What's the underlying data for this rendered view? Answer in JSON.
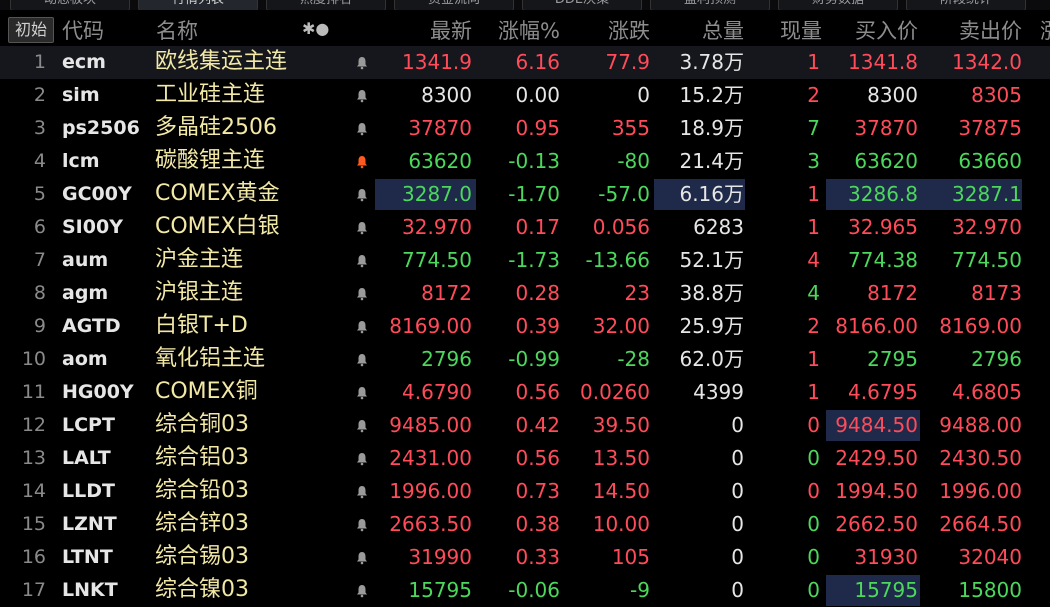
{
  "tabs": [
    "动态板块",
    "行情列表",
    "热度排名",
    "资金流向",
    "DDE决策",
    "盈利预测",
    "财务数据",
    "阶段统计"
  ],
  "init_button": "初始",
  "header": {
    "code": "代码",
    "name": "名称",
    "icon": "✱●",
    "latest": "最新",
    "change_pct": "涨幅%",
    "change": "涨跌",
    "volume": "总量",
    "current": "现量",
    "bid": "买入价",
    "ask": "卖出价",
    "extra": "涨"
  },
  "colors": {
    "up": "#ff4b5a",
    "down": "#4bd85c",
    "flat": "#e6e6e6",
    "name": "#f3e9a6",
    "alert": "#ff5a1f"
  },
  "rows": [
    {
      "num": "1",
      "code": "ecm",
      "name": "欧线集运主连",
      "latest": "1341.9",
      "pct": "6.16",
      "chg": "77.9",
      "vol": "3.78万",
      "cur": "1",
      "bid": "1341.8",
      "ask": "1342.0",
      "c": [
        "red",
        "red",
        "red",
        "red",
        "red",
        "red"
      ],
      "bell": "grey"
    },
    {
      "num": "2",
      "code": "sim",
      "name": "工业硅主连",
      "latest": "8300",
      "pct": "0.00",
      "chg": "0",
      "vol": "15.2万",
      "cur": "2",
      "bid": "8300",
      "ask": "8305",
      "c": [
        "white",
        "white",
        "white",
        "red",
        "white",
        "red"
      ],
      "bell": "grey"
    },
    {
      "num": "3",
      "code": "ps2506",
      "name": "多晶硅2506",
      "latest": "37870",
      "pct": "0.95",
      "chg": "355",
      "vol": "18.9万",
      "cur": "7",
      "bid": "37870",
      "ask": "37875",
      "c": [
        "red",
        "red",
        "red",
        "green",
        "red",
        "red"
      ],
      "bell": "grey"
    },
    {
      "num": "4",
      "code": "lcm",
      "name": "碳酸锂主连",
      "latest": "63620",
      "pct": "-0.13",
      "chg": "-80",
      "vol": "21.4万",
      "cur": "3",
      "bid": "63620",
      "ask": "63660",
      "c": [
        "green",
        "green",
        "green",
        "green",
        "green",
        "green"
      ],
      "bell": "alert"
    },
    {
      "num": "5",
      "code": "GC00Y",
      "name": "COMEX黄金",
      "latest": "3287.0",
      "pct": "-1.70",
      "chg": "-57.0",
      "vol": "6.16万",
      "cur": "1",
      "bid": "3286.8",
      "ask": "3287.1",
      "c": [
        "green",
        "green",
        "green",
        "red",
        "green",
        "green"
      ],
      "bell": "grey"
    },
    {
      "num": "6",
      "code": "SI00Y",
      "name": "COMEX白银",
      "latest": "32.970",
      "pct": "0.17",
      "chg": "0.056",
      "vol": "6283",
      "cur": "1",
      "bid": "32.965",
      "ask": "32.970",
      "c": [
        "red",
        "red",
        "red",
        "red",
        "red",
        "red"
      ],
      "bell": "grey"
    },
    {
      "num": "7",
      "code": "aum",
      "name": "沪金主连",
      "latest": "774.50",
      "pct": "-1.73",
      "chg": "-13.66",
      "vol": "52.1万",
      "cur": "4",
      "bid": "774.38",
      "ask": "774.50",
      "c": [
        "green",
        "green",
        "green",
        "red",
        "green",
        "green"
      ],
      "bell": "grey"
    },
    {
      "num": "8",
      "code": "agm",
      "name": "沪银主连",
      "latest": "8172",
      "pct": "0.28",
      "chg": "23",
      "vol": "38.8万",
      "cur": "4",
      "bid": "8172",
      "ask": "8173",
      "c": [
        "red",
        "red",
        "red",
        "green",
        "red",
        "red"
      ],
      "bell": "grey"
    },
    {
      "num": "9",
      "code": "AGTD",
      "name": "白银T+D",
      "latest": "8169.00",
      "pct": "0.39",
      "chg": "32.00",
      "vol": "25.9万",
      "cur": "2",
      "bid": "8166.00",
      "ask": "8169.00",
      "c": [
        "red",
        "red",
        "red",
        "red",
        "red",
        "red"
      ],
      "bell": "grey"
    },
    {
      "num": "10",
      "code": "aom",
      "name": "氧化铝主连",
      "latest": "2796",
      "pct": "-0.99",
      "chg": "-28",
      "vol": "62.0万",
      "cur": "1",
      "bid": "2795",
      "ask": "2796",
      "c": [
        "green",
        "green",
        "green",
        "red",
        "green",
        "green"
      ],
      "bell": "grey"
    },
    {
      "num": "11",
      "code": "HG00Y",
      "name": "COMEX铜",
      "latest": "4.6790",
      "pct": "0.56",
      "chg": "0.0260",
      "vol": "4399",
      "cur": "1",
      "bid": "4.6795",
      "ask": "4.6805",
      "c": [
        "red",
        "red",
        "red",
        "red",
        "red",
        "red"
      ],
      "bell": "grey"
    },
    {
      "num": "12",
      "code": "LCPT",
      "name": "综合铜03",
      "latest": "9485.00",
      "pct": "0.42",
      "chg": "39.50",
      "vol": "0",
      "cur": "0",
      "bid": "9484.50",
      "ask": "9488.00",
      "c": [
        "red",
        "red",
        "red",
        "red",
        "red",
        "red"
      ],
      "bell": "grey"
    },
    {
      "num": "13",
      "code": "LALT",
      "name": "综合铝03",
      "latest": "2431.00",
      "pct": "0.56",
      "chg": "13.50",
      "vol": "0",
      "cur": "0",
      "bid": "2429.50",
      "ask": "2430.50",
      "c": [
        "red",
        "red",
        "red",
        "green",
        "red",
        "red"
      ],
      "bell": "grey"
    },
    {
      "num": "14",
      "code": "LLDT",
      "name": "综合铅03",
      "latest": "1996.00",
      "pct": "0.73",
      "chg": "14.50",
      "vol": "0",
      "cur": "0",
      "bid": "1994.50",
      "ask": "1996.00",
      "c": [
        "red",
        "red",
        "red",
        "red",
        "red",
        "red"
      ],
      "bell": "grey"
    },
    {
      "num": "15",
      "code": "LZNT",
      "name": "综合锌03",
      "latest": "2663.50",
      "pct": "0.38",
      "chg": "10.00",
      "vol": "0",
      "cur": "0",
      "bid": "2662.50",
      "ask": "2664.50",
      "c": [
        "red",
        "red",
        "red",
        "green",
        "red",
        "red"
      ],
      "bell": "grey"
    },
    {
      "num": "16",
      "code": "LTNT",
      "name": "综合锡03",
      "latest": "31990",
      "pct": "0.33",
      "chg": "105",
      "vol": "0",
      "cur": "0",
      "bid": "31930",
      "ask": "32040",
      "c": [
        "red",
        "red",
        "red",
        "green",
        "red",
        "red"
      ],
      "bell": "grey"
    },
    {
      "num": "17",
      "code": "LNKT",
      "name": "综合镍03",
      "latest": "15795",
      "pct": "-0.06",
      "chg": "-9",
      "vol": "0",
      "cur": "0",
      "bid": "15795",
      "ask": "15800",
      "c": [
        "green",
        "green",
        "green",
        "green",
        "green",
        "green"
      ],
      "bell": "grey"
    }
  ]
}
